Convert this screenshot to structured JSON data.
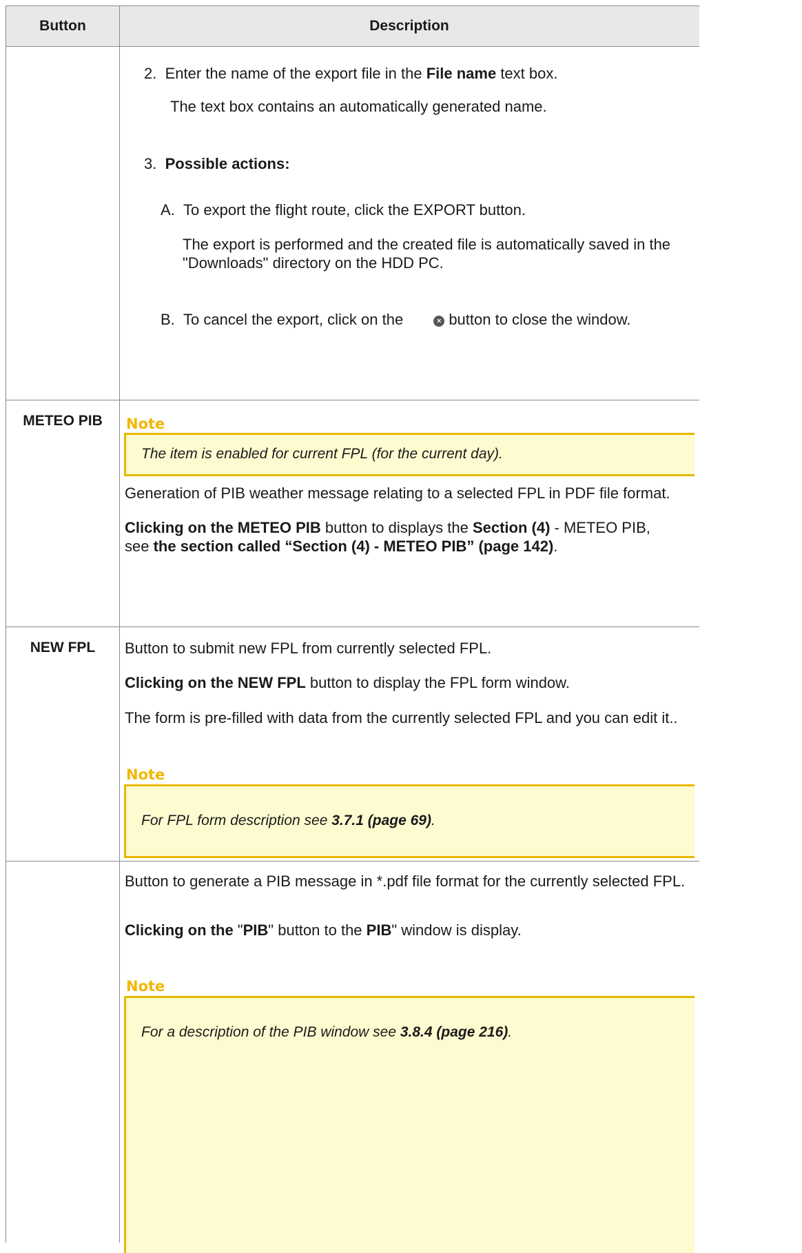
{
  "header": {
    "col_button": "Button",
    "col_description": "Description"
  },
  "row1": {
    "step2_num": "2.",
    "step2_a": "Enter the name of the export file in the ",
    "step2_bold": "File name",
    "step2_b": " text box.",
    "step2_sub": "The text box contains an automatically generated name.",
    "step3_num": "3.",
    "step3_label": "Possible actions:",
    "a_num": "A.",
    "a_text": "To export the flight route, click the EXPORT button.",
    "a_sub_1": "The export is performed and the created file is automatically saved in the",
    "a_sub_2": "\"Downloads\" directory on the HDD PC.",
    "b_num": "B.",
    "b_text_1": "To cancel the export, click on the",
    "b_icon": "×",
    "b_text_2": " button to close the window."
  },
  "row2": {
    "label": "METEO PIB",
    "note_title": "Note",
    "note_text": "The item is enabled for current FPL (for the current day).",
    "p1": "Generation of PIB weather message relating to a selected FPL in PDF file format.",
    "p2_bold1": "Clicking on the METEO PIB",
    "p2_a": " button to displays the ",
    "p2_bold2": "Section (4)",
    "p2_b": " - METEO PIB,",
    "p2_c": "see ",
    "p2_bold3": "the section called “Section (4) - METEO PIB” (page 142)",
    "p2_d": "."
  },
  "row3": {
    "label": "NEW FPL",
    "p1": "Button to submit new FPL from currently selected FPL.",
    "p2_bold": "Clicking on the NEW FPL",
    "p2_text": " button to display the FPL form window.",
    "p3": "The form is pre-filled with data from the currently selected FPL and you can edit it..",
    "note_title": "Note",
    "note_a": "For FPL form description see ",
    "note_bold": "3.7.1 (page 69)",
    "note_b": "."
  },
  "row4": {
    "p1": "Button to generate a PIB message in *.pdf file format for the currently selected FPL.",
    "p2_bold1": "Clicking on the",
    "p2_a": " \"",
    "p2_bold2": "PIB",
    "p2_b": "\" button to the ",
    "p2_bold3": "PIB",
    "p2_c": "\" window is display.",
    "note_title": "Note",
    "note_a": "For a description of the PIB window see ",
    "note_bold": "3.8.4 (page 216)",
    "note_b": "."
  },
  "colors": {
    "note_accent": "#f2b705",
    "note_bg": "#fffbd0",
    "header_bg": "#e8e8e8"
  }
}
